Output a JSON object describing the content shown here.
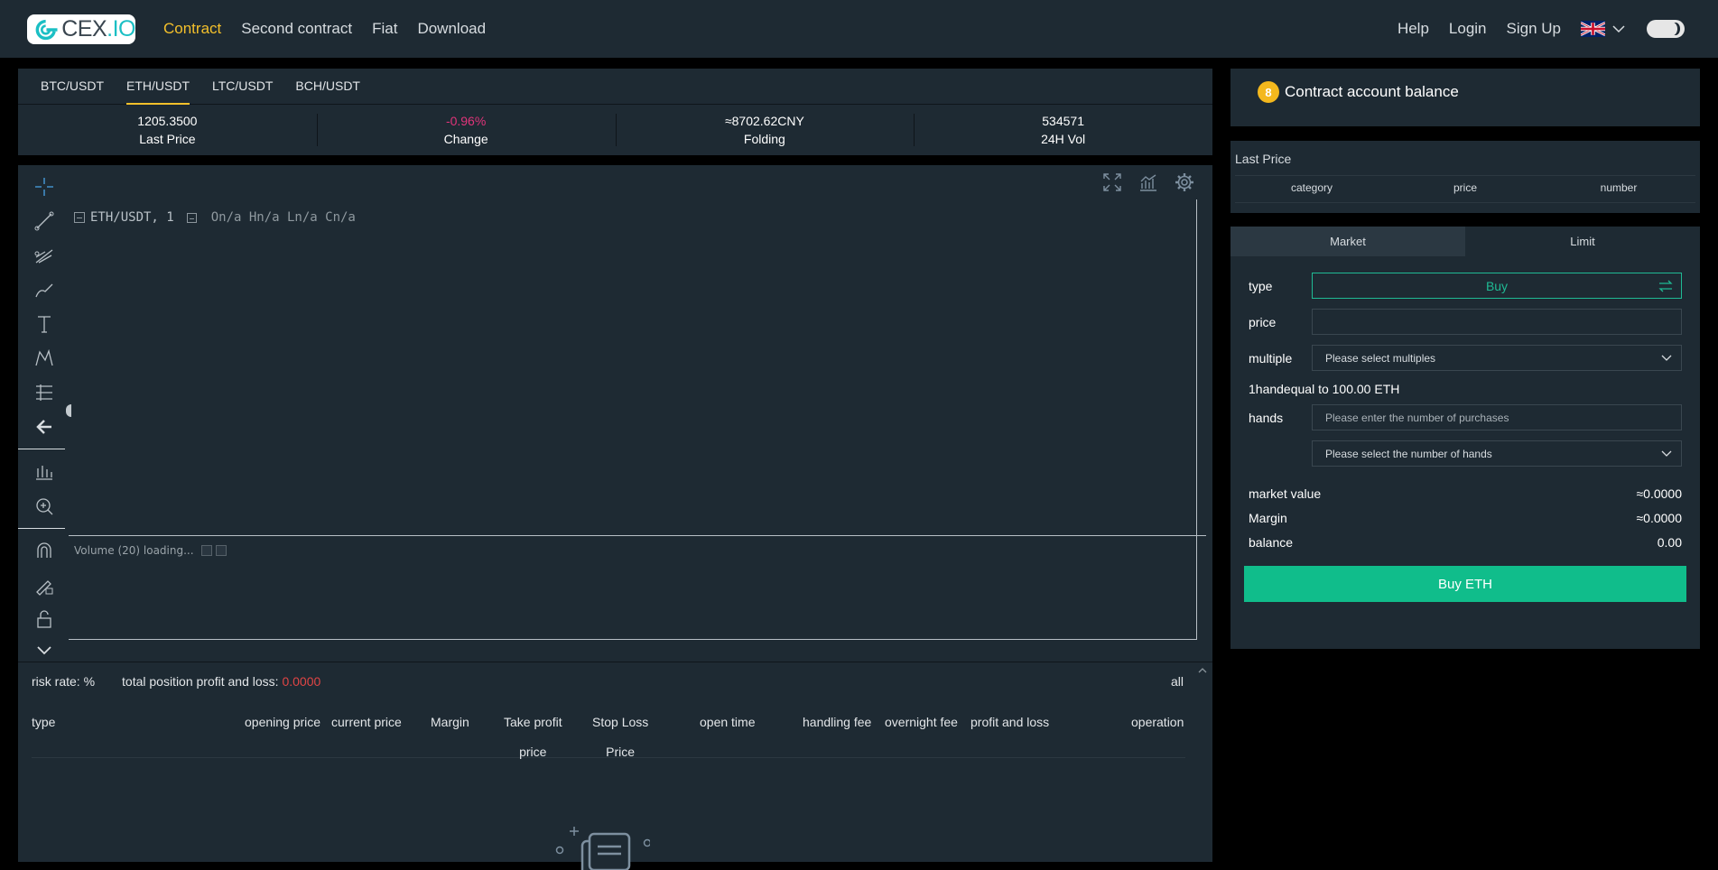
{
  "brand": {
    "logo_text_main": "CEX",
    "logo_text_dot": ".",
    "logo_text_io": "IO"
  },
  "nav": {
    "items": [
      "Contract",
      "Second contract",
      "Fiat",
      "Download"
    ],
    "active": "Contract"
  },
  "nav_right": {
    "help": "Help",
    "login": "Login",
    "signup": "Sign Up"
  },
  "pairs": [
    "BTC/USDT",
    "ETH/USDT",
    "LTC/USDT",
    "BCH/USDT"
  ],
  "active_pair": "ETH/USDT",
  "stats": [
    {
      "value": "1205.3500",
      "label": "Last Price"
    },
    {
      "value": "-0.96%",
      "label": "Change"
    },
    {
      "value": "≈8702.62CNY",
      "label": "Folding"
    },
    {
      "value": "534571",
      "label": "24H Vol"
    }
  ],
  "chart": {
    "symbol": "ETH/USDT, 1",
    "ohlc": "On/a Hn/a Ln/a Cn/a",
    "volume_label": "Volume (20) loading..."
  },
  "positions": {
    "risk_rate": "risk rate: %",
    "total_pnl_label": "total position profit and loss:",
    "total_pnl_value": "0.0000",
    "all": "all",
    "columns": [
      {
        "l1": "type",
        "l2": ""
      },
      {
        "l1": "opening price",
        "l2": ""
      },
      {
        "l1": "current price",
        "l2": ""
      },
      {
        "l1": "Margin",
        "l2": ""
      },
      {
        "l1": "Take profit",
        "l2": "price"
      },
      {
        "l1": "Stop Loss",
        "l2": "Price"
      },
      {
        "l1": "open time",
        "l2": ""
      },
      {
        "l1": "handling fee",
        "l2": ""
      },
      {
        "l1": "overnight fee",
        "l2": ""
      },
      {
        "l1": "profit and loss",
        "l2": ""
      },
      {
        "l1": "operation",
        "l2": ""
      }
    ]
  },
  "account": {
    "title": "Contract account balance"
  },
  "last_price": {
    "title": "Last Price",
    "columns": [
      "category",
      "price",
      "number"
    ]
  },
  "order": {
    "tabs": [
      "Market",
      "Limit"
    ],
    "active_tab": "Market",
    "type_label": "type",
    "type_value": "Buy",
    "price_label": "price",
    "price_value": "",
    "multiple_label": "multiple",
    "multiple_placeholder": "Please select multiples",
    "hand_info": "1handequal to 100.00 ETH",
    "hands_label": "hands",
    "hands_placeholder": "Please enter the number of purchases",
    "hands_select_placeholder": "Please select the number of hands",
    "market_value_label": "market value",
    "market_value": "≈0.0000",
    "margin_label": "Margin",
    "margin_value": "≈0.0000",
    "balance_label": "balance",
    "balance_value": "0.00",
    "buy_button": "Buy ETH"
  },
  "colors": {
    "accent": "#f4c02b",
    "buy": "#10bd8b",
    "negative": "#e0347a",
    "panel": "#1e2a33"
  }
}
